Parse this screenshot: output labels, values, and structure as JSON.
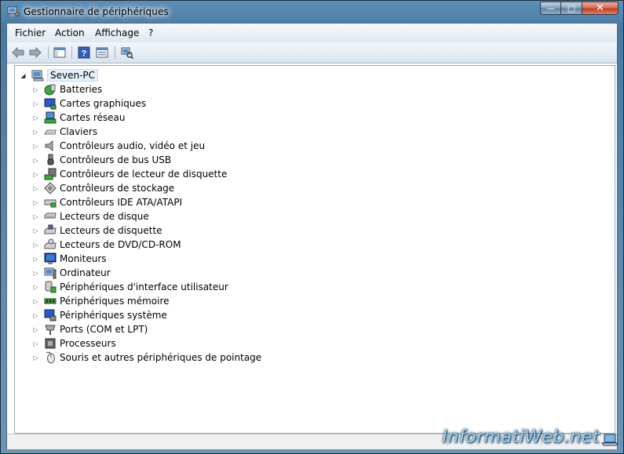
{
  "window": {
    "title": "Gestionnaire de périphériques",
    "minimize_glyph": "—",
    "maximize_glyph": "□",
    "close_glyph": "✕"
  },
  "menu": [
    {
      "label": "Fichier"
    },
    {
      "label": "Action"
    },
    {
      "label": "Affichage"
    },
    {
      "label": "?"
    }
  ],
  "toolbar": {
    "buttons": [
      "back-arrow-icon",
      "forward-arrow-icon",
      "console-tree-icon",
      "help-icon",
      "properties-icon",
      "scan-hardware-icon"
    ]
  },
  "tree": {
    "root": {
      "label": "Seven-PC",
      "icon": "computer-icon",
      "expander": "◢"
    },
    "categories": [
      {
        "label": "Batteries",
        "icon": "battery-icon"
      },
      {
        "label": "Cartes graphiques",
        "icon": "display-adapter-icon"
      },
      {
        "label": "Cartes réseau",
        "icon": "network-adapter-icon"
      },
      {
        "label": "Claviers",
        "icon": "keyboard-icon"
      },
      {
        "label": "Contrôleurs audio, vidéo et jeu",
        "icon": "speaker-icon"
      },
      {
        "label": "Contrôleurs de bus USB",
        "icon": "usb-icon"
      },
      {
        "label": "Contrôleurs de lecteur de disquette",
        "icon": "floppy-controller-icon"
      },
      {
        "label": "Contrôleurs de stockage",
        "icon": "storage-controller-icon"
      },
      {
        "label": "Contrôleurs IDE ATA/ATAPI",
        "icon": "ide-controller-icon"
      },
      {
        "label": "Lecteurs de disque",
        "icon": "disk-drive-icon"
      },
      {
        "label": "Lecteurs de disquette",
        "icon": "floppy-drive-icon"
      },
      {
        "label": "Lecteurs de DVD/CD-ROM",
        "icon": "dvd-drive-icon"
      },
      {
        "label": "Moniteurs",
        "icon": "monitor-icon"
      },
      {
        "label": "Ordinateur",
        "icon": "computer-icon"
      },
      {
        "label": "Périphériques d'interface utilisateur",
        "icon": "hid-icon"
      },
      {
        "label": "Périphériques mémoire",
        "icon": "memory-icon"
      },
      {
        "label": "Périphériques système",
        "icon": "system-device-icon"
      },
      {
        "label": "Ports (COM et LPT)",
        "icon": "port-icon"
      },
      {
        "label": "Processeurs",
        "icon": "processor-icon"
      },
      {
        "label": "Souris et autres périphériques de pointage",
        "icon": "mouse-icon"
      }
    ],
    "collapsed_expander": "▷"
  },
  "watermark": {
    "text": "InformatiWeb.net"
  },
  "colors": {
    "accent": "#3a6ea5",
    "selection": "#e6f0fa",
    "titlebar": "#5d8fb6"
  }
}
